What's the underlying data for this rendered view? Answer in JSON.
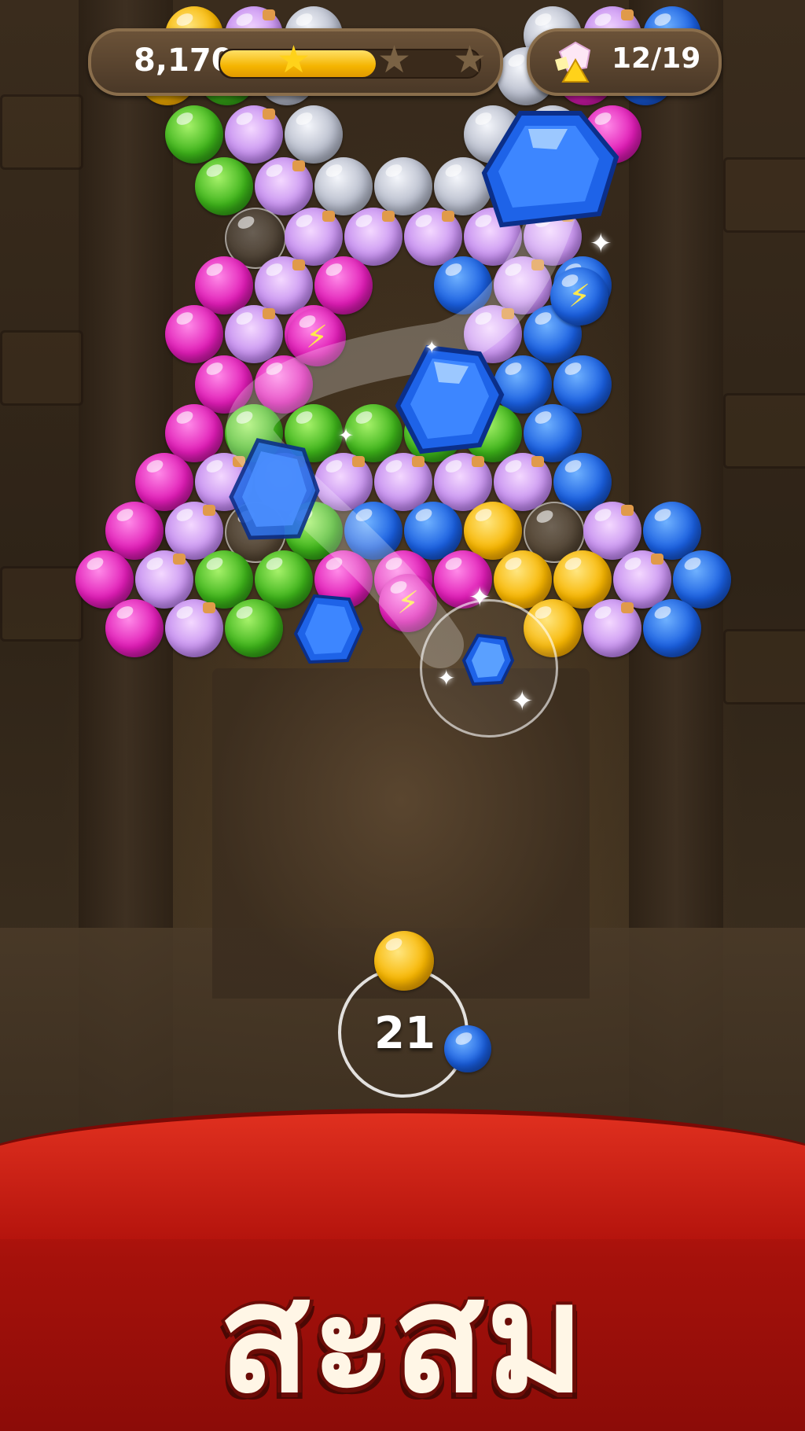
{
  "hud": {
    "score": "8,170",
    "progress_fraction": 0.6,
    "stars_earned": 1,
    "stars_total": 3,
    "goal": "12/19"
  },
  "launcher": {
    "shots_left": "21",
    "current_ball_color": "yellow",
    "next_ball_color": "blue"
  },
  "banner": {
    "title": "สะสม"
  },
  "colors": {
    "banner_red": "#b5140d",
    "progress_gold": "#f4b400",
    "panel_brown": "#5a4430"
  },
  "icons": {
    "goal": "gem-cluster-icon",
    "star": "star-icon",
    "powerup": "lightning-icon"
  }
}
